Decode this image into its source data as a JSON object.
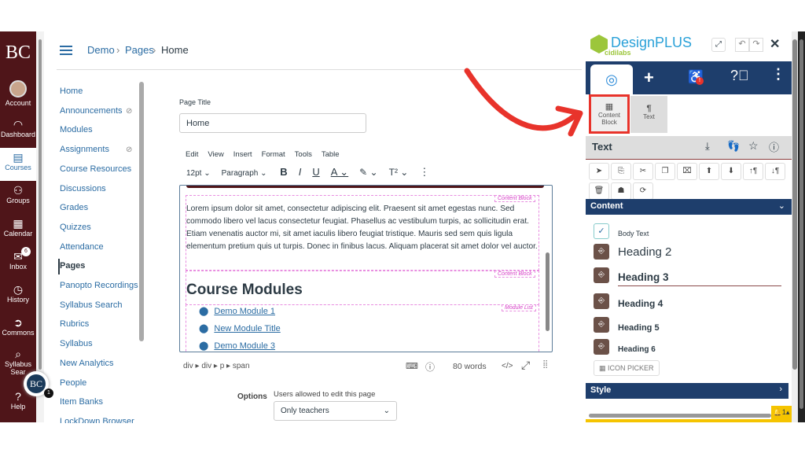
{
  "global_nav": {
    "logo": "BC",
    "items": [
      {
        "label": "Account",
        "icon": "avatar"
      },
      {
        "label": "Dashboard",
        "icon": "dashboard-icon"
      },
      {
        "label": "Courses",
        "icon": "book-icon",
        "active": true
      },
      {
        "label": "Groups",
        "icon": "groups-icon"
      },
      {
        "label": "Calendar",
        "icon": "calendar-icon"
      },
      {
        "label": "Inbox",
        "icon": "inbox-icon",
        "badge": "6"
      },
      {
        "label": "History",
        "icon": "clock-icon"
      },
      {
        "label": "Commons",
        "icon": "commons-icon"
      },
      {
        "label": "Syllabus Sear",
        "icon": "search-icon"
      },
      {
        "label": "Help",
        "icon": "help-icon",
        "badge": "1"
      }
    ],
    "floating_badge": {
      "logo": "BC",
      "count": "1"
    }
  },
  "breadcrumb": [
    "Demo",
    "Pages",
    "Home"
  ],
  "course_nav": [
    "Home",
    "Announcements",
    "Modules",
    "Assignments",
    "Course Resources",
    "Discussions",
    "Grades",
    "Quizzes",
    "Attendance",
    "Pages",
    "Panopto Recordings",
    "Syllabus Search",
    "Rubrics",
    "Syllabus",
    "New Analytics",
    "People",
    "Item Banks",
    "LockDown Browser"
  ],
  "course_nav_active": "Pages",
  "page_title_label": "Page Title",
  "page_title_value": "Home",
  "editor": {
    "menu": [
      "Edit",
      "View",
      "Insert",
      "Format",
      "Tools",
      "Table"
    ],
    "font_size": "12pt",
    "block_format": "Paragraph",
    "body_words": [
      "Lorem ipsum dolor sit amet, consectetur adipiscing elit. Praesent sit amet egestas nunc. Sed commodo libero vel lacus consectetur feugiat. Phasellus ac vestibulum turpis, ac sollicitudin erat. Etiam venenatis auctor mi, sit amet iaculis libero feugiat tristique. Mauris sed sem quis ligula elementum pretium quis ut turpis. Donec in finibus lacus. Aliquam placerat sit amet dolor vel auctor."
    ],
    "tag_content_block": "Content Block",
    "tag_module_list": "Module List",
    "heading": "Course Modules",
    "modules": [
      "Demo Module 1",
      "New Module Title",
      "Demo Module 3"
    ],
    "path": "div ▸ div ▸ p ▸ span",
    "word_count": "80 words"
  },
  "options": {
    "label": "Options",
    "sub_label": "Users allowed to edit this page",
    "value": "Only teachers"
  },
  "designplus": {
    "brand": "DesignPLUS",
    "sub_brand": "cidilabs",
    "tabs": [
      "target-icon",
      "plus-icon",
      "accessibility-icon",
      "help-icon",
      "more-icon"
    ],
    "block_types": [
      {
        "label": "Content Block",
        "icon": "table-icon"
      },
      {
        "label": "Text",
        "icon": "pilcrow-icon"
      }
    ],
    "section_title": "Text",
    "content_header": "Content",
    "styles": [
      "Body Text",
      "Heading 2",
      "Heading 3",
      "Heading 4",
      "Heading 5",
      "Heading 6"
    ],
    "icon_picker": "ICON PICKER",
    "style_header": "Style",
    "notify_count": "1",
    "colors": {
      "navy": "#1e3e6c",
      "brown": "#6b5148",
      "highlight": "#e8332b",
      "notify": "#f5c400"
    }
  }
}
